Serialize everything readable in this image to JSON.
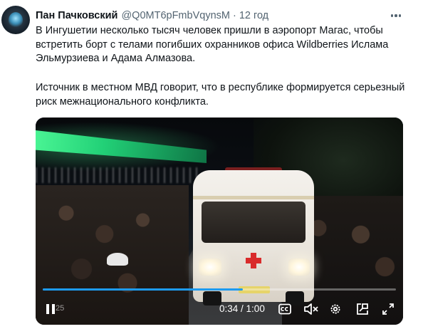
{
  "tweet": {
    "author_name": "Пан Пачковский",
    "handle": "@Q0MT6pFmbVqynsM",
    "separator": "·",
    "time": "12 год",
    "paragraph_1": "В Ингушетии несколько тысяч человек пришли в аэропорт Магас, чтобы встретить борт с телами погибших охранников офиса Wildberries Ислама Эльмурзиева и Адама Алмазова.",
    "paragraph_2": "Источник в местном МВД говорит, что в республике формируется серьезный риск межнационального конфликта."
  },
  "video": {
    "current_time": "0:34",
    "duration": "1:00",
    "time_separator": " / ",
    "progress_fraction": 0.567,
    "overlay_text": "25",
    "progress_color": "#1d9bf0"
  },
  "icons": {
    "more": "more-horizontal-icon",
    "pause": "pause-icon",
    "cc": "closed-captions-icon",
    "mute": "muted-speaker-icon",
    "settings": "gear-icon",
    "pip": "picture-in-picture-icon",
    "fullscreen": "fullscreen-icon"
  },
  "colors": {
    "text_primary": "#0f1419",
    "text_secondary": "#536471"
  }
}
